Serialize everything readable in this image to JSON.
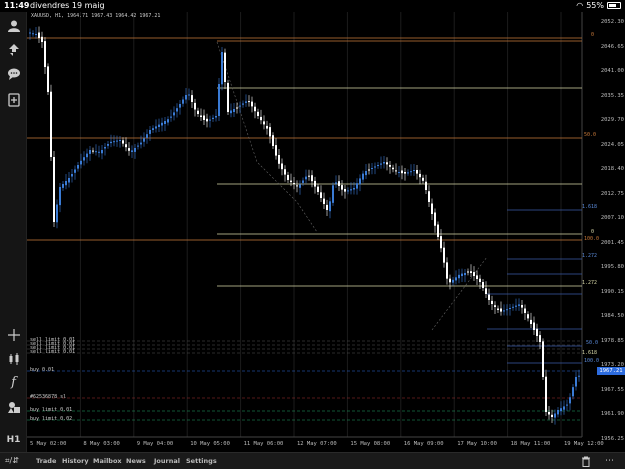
{
  "status_bar": {
    "time": "11:49",
    "date": "divendres 19 maig",
    "battery": "55%",
    "battery_level": 0.55
  },
  "left_toolbar": {
    "icons": [
      "account-icon",
      "trade-up-down-icon",
      "chat-icon",
      "new-chart-icon",
      "crosshair-icon",
      "candlestick-type-icon",
      "indicators-icon",
      "objects-icon"
    ],
    "timeframe": "H1"
  },
  "chart": {
    "symbol_info": "XAUUSD, H1, 1964.71 1967.43 1964.42 1967.21",
    "colors": {
      "bull": "#3a7bd5",
      "bear": "#ffffff",
      "grid": "#333333"
    },
    "price_ticks": [
      "2052.30",
      "2046.65",
      "2041.00",
      "2035.35",
      "2029.70",
      "2024.05",
      "2018.40",
      "2012.75",
      "2007.10",
      "2001.45",
      "1995.80",
      "1990.15",
      "1984.50",
      "1978.85",
      "1973.20",
      "1967.55",
      "1961.90",
      "1956.25"
    ],
    "time_ticks": [
      "5 May 02:00",
      "8 May 03:00",
      "9 May 04:00",
      "10 May 05:00",
      "11 May 06:00",
      "12 May 07:00",
      "15 May 08:00",
      "16 May 09:00",
      "17 May 10:00",
      "18 May 11:00",
      "19 May 12:00"
    ],
    "current_price": "1967.21",
    "fib_labels": {
      "zero_top": "0",
      "fifty": "50.0",
      "zero_mid": "0",
      "hundred": "100.0",
      "one_618": "1.618",
      "one_272_a": "1.272",
      "one_272_b": "1.272",
      "one_618_b": "1.618",
      "small_a": "50.0",
      "small_b": "100.0"
    },
    "orders": [
      {
        "label": "sell limit 0.01"
      },
      {
        "label": "sell limit 0.01"
      },
      {
        "label": "sell limit 0.01"
      },
      {
        "label": "sell limit 0.01"
      },
      {
        "label": "buy 0.01"
      },
      {
        "label": "#62536878 sl"
      },
      {
        "label": "buy limit 0.01"
      },
      {
        "label": "buy limit 0.02"
      }
    ]
  },
  "bottom_bar": {
    "tabs": [
      "Trade",
      "History",
      "Mailbox",
      "News",
      "Journal",
      "Settings"
    ],
    "active_tab": "News"
  }
}
